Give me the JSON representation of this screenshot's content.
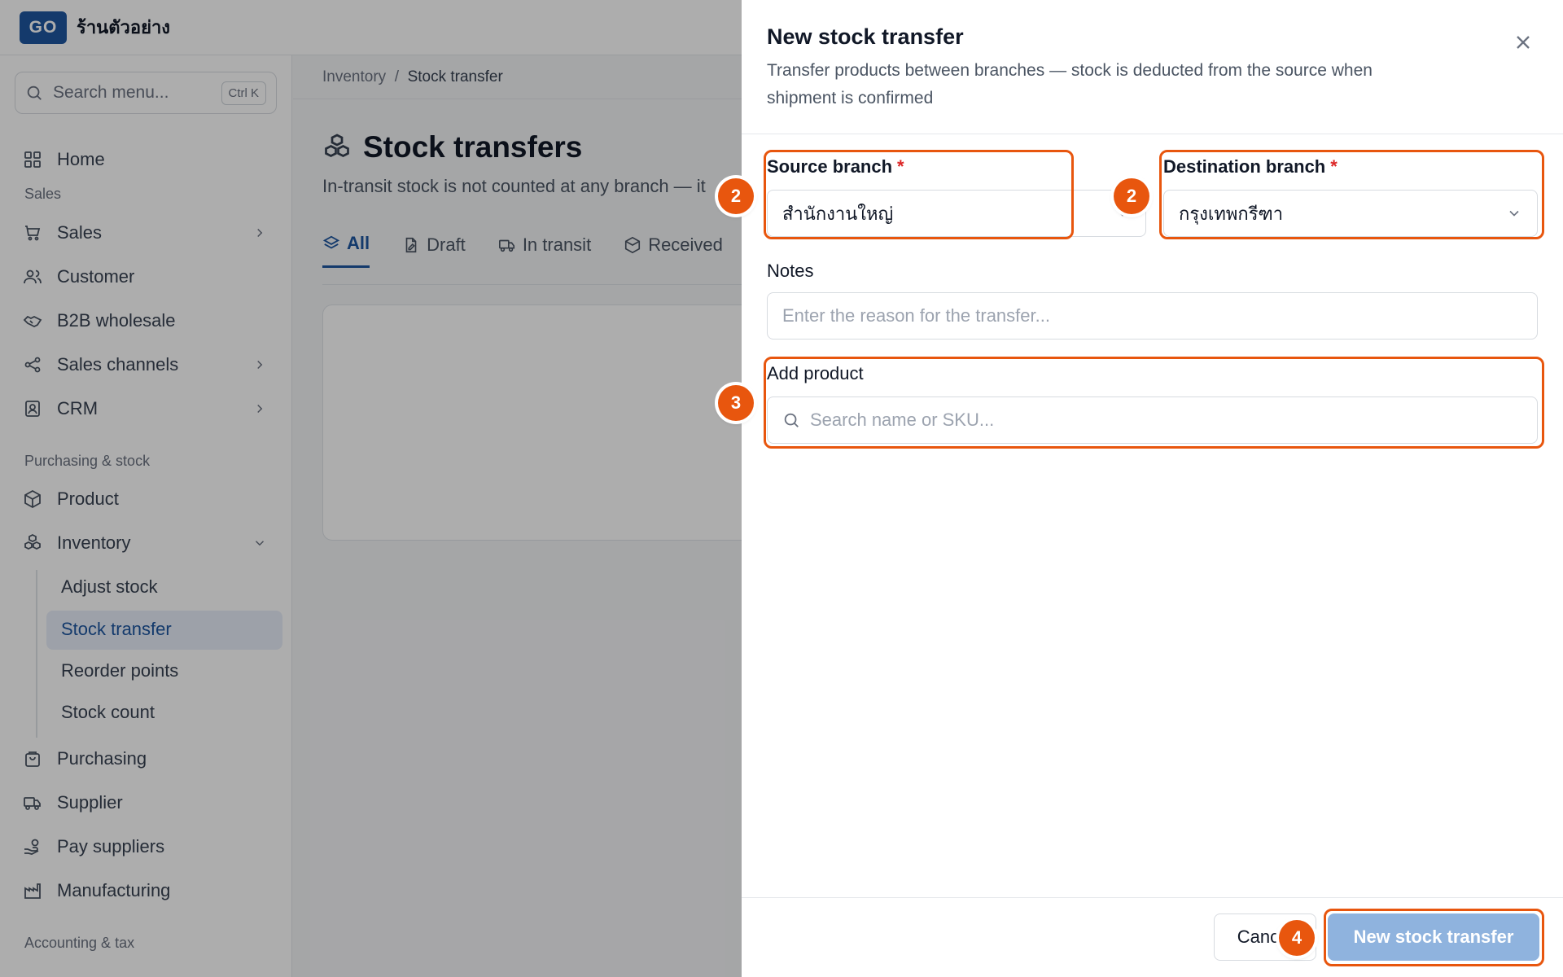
{
  "app": {
    "logo": "GO",
    "shop_name": "ร้านตัวอย่าง"
  },
  "sidebar": {
    "search_placeholder": "Search menu...",
    "search_shortcut": "Ctrl K",
    "home": "Home",
    "section_sales": "Sales",
    "sales": "Sales",
    "customer": "Customer",
    "b2b": "B2B wholesale",
    "sales_channels": "Sales channels",
    "crm": "CRM",
    "section_purchasing": "Purchasing & stock",
    "product": "Product",
    "inventory": "Inventory",
    "inventory_sub": [
      "Adjust stock",
      "Stock transfer",
      "Reorder points",
      "Stock count"
    ],
    "purchasing": "Purchasing",
    "supplier": "Supplier",
    "pay_suppliers": "Pay suppliers",
    "manufacturing": "Manufacturing",
    "section_accounting": "Accounting & tax"
  },
  "main": {
    "breadcrumb": [
      "Inventory",
      "Stock transfer"
    ],
    "title": "Stock transfers",
    "subtitle": "In-transit stock is not counted at any branch — it",
    "tabs": [
      "All",
      "Draft",
      "In transit",
      "Received"
    ]
  },
  "drawer": {
    "title": "New stock transfer",
    "description": "Transfer products between branches — stock is deducted from the source when shipment is confirmed",
    "source_label": "Source branch",
    "source_value": "สำนักงานใหญ่",
    "dest_label": "Destination branch",
    "dest_value": "กรุงเทพกรีฑา",
    "required_mark": "*",
    "notes_label": "Notes",
    "notes_placeholder": "Enter the reason for the transfer...",
    "add_product_label": "Add product",
    "product_search_placeholder": "Search name or SKU...",
    "cancel_label": "Cancel",
    "submit_label": "New stock transfer"
  },
  "annotations": {
    "step_source": "2",
    "step_dest": "2",
    "step_product": "3",
    "step_submit": "4"
  },
  "colors": {
    "brand": "#1e56a0",
    "highlight": "#e8560e",
    "primary_disabled": "#8fb3de"
  }
}
